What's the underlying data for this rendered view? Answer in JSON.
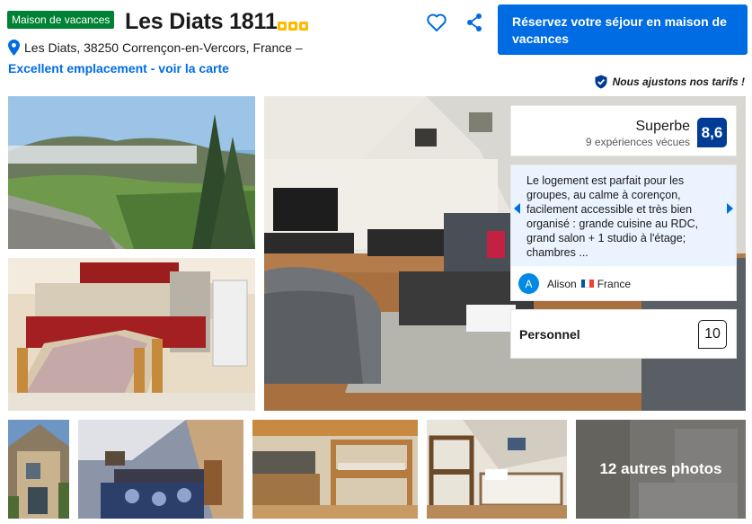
{
  "header": {
    "type_badge": "Maison de vacances",
    "title": "Les Diats 1811",
    "stars": 3,
    "address": "Les Diats, 38250 Corrençon-en-Vercors, France –",
    "location_link": "Excellent emplacement - voir la carte",
    "reserve_button": "Réservez votre séjour en maison de vacances",
    "price_match": "Nous ajustons nos tarifs !"
  },
  "icons": {
    "favorite": "heart-icon",
    "share": "share-icon",
    "location": "map-pin-icon",
    "price_match": "shield-check-icon",
    "review_prev": "chevron-left-icon",
    "review_next": "chevron-right-icon"
  },
  "rating": {
    "word": "Superbe",
    "count": "9 expériences vécues",
    "score": "8,6"
  },
  "review": {
    "text": "Le logement est parfait pour les groupes, au calme à corençon, facilement accessible et très bien organisé : grande cuisine au RDC, grand salon + 1 studio à l'étage; chambres ...",
    "avatar_initial": "A",
    "reviewer": "Alison",
    "country": "France"
  },
  "subscore": {
    "label": "Personnel",
    "score": "10"
  },
  "gallery": {
    "more_photos": "12 autres photos"
  },
  "colors": {
    "brand_blue": "#006ce4",
    "score_navy": "#003b95",
    "badge_green": "#008234",
    "star_yellow": "#febb02",
    "review_bg": "#ebf3ff"
  }
}
